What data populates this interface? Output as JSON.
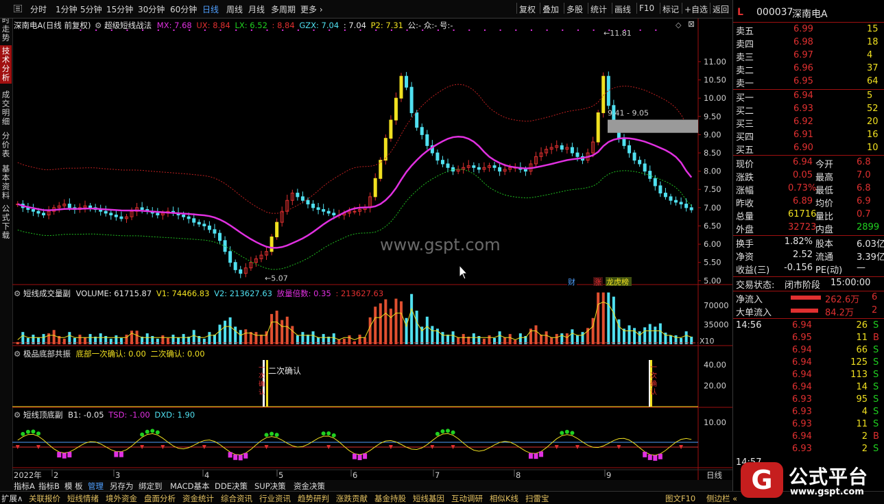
{
  "toolbar": {
    "periods": [
      "分时",
      "1分钟",
      "5分钟",
      "15分钟",
      "30分钟",
      "60分钟",
      "日线",
      "周线",
      "月线",
      "多周期",
      "更多"
    ],
    "active_period": "日线",
    "right_buttons": [
      "复权",
      "叠加",
      "多股",
      "统计",
      "画线",
      "F10",
      "标记",
      "+自选",
      "返回"
    ]
  },
  "left_tabs": [
    {
      "label": "分时走势",
      "active": false
    },
    {
      "label": "技术分析",
      "active": true
    },
    {
      "label": "成交明细",
      "active": false
    },
    {
      "label": "分价表",
      "active": false
    },
    {
      "label": "基本资料",
      "active": false
    },
    {
      "label": "公式下载",
      "active": false
    }
  ],
  "main_info": {
    "title": "深南电A(日线 前复权)",
    "indicator": "超级短线战法",
    "mx_label": "MX: 7.68",
    "ux_label": "UX: 8.84",
    "lx_label": "LX: 6.52",
    "v4_label": ": 8.84",
    "gzx_label": "GZX: 7.04",
    "v6_label": ": 7.04",
    "p2_label": "P2: 7.31",
    "tail_label": "公:- 众:- 号:-"
  },
  "annotations": {
    "high": "11.81",
    "low": "5.07",
    "zone": "9.41 - 9.05",
    "watermark": "www.gspt.com",
    "tags": [
      "财",
      "涨",
      "龙虎榜"
    ],
    "confirm1": "二次确认",
    "confirm2": "一次确认",
    "confirm_left": "一次确认"
  },
  "vol_info": {
    "title": "短线成交量副",
    "volume": "VOLUME: 61715.87",
    "v1": "V1: 74466.83",
    "v2": "V2: 213627.63",
    "ratio": "放量倍数: 0.35",
    "ratio2": ": 213627.63",
    "x10": "X10"
  },
  "res_info": {
    "title": "极品底部共振",
    "first": "底部一次确认: 0.00",
    "second": "二次确认: 0.00"
  },
  "td_info": {
    "title": "短线顶底副",
    "b1": "B1: -0.05",
    "tsd": "TSD: -1.00",
    "dxd": "DXD: 1.90"
  },
  "price_axis": [
    "11.00",
    "10.50",
    "10.00",
    "9.50",
    "9.00",
    "8.50",
    "8.00",
    "7.50",
    "7.00",
    "6.50",
    "6.00",
    "5.50",
    "5.00"
  ],
  "vol_axis": [
    "70000",
    "35000"
  ],
  "res_axis": [
    "40.00",
    "20.00"
  ],
  "td_axis": [
    "10.00"
  ],
  "date_axis": {
    "year": "2022年",
    "months": [
      "2",
      "3",
      "4",
      "5",
      "6",
      "7",
      "8",
      "9"
    ],
    "period": "日线"
  },
  "bottom_tabs": [
    "指标A",
    "指标B",
    "模 板",
    "管理",
    "另存为",
    "绑定到",
    "MACD基本",
    "DDE决策",
    "SUP决策",
    "资金决策"
  ],
  "footer_tabs": [
    "扩展∧",
    "关联报价",
    "短线情绪",
    "境外资金",
    "盘面分析",
    "资金统计",
    "综合资讯",
    "行业资讯",
    "趋势研判",
    "涨跌贡献",
    "基金持股",
    "短线基因",
    "互动调研",
    "相似K线",
    "扫雷宝",
    "图文F10",
    "侧边栏 «"
  ],
  "quote": {
    "flag": "L",
    "code": "000037",
    "name": "深南电A",
    "asks": [
      {
        "label": "卖五",
        "price": "6.99",
        "vol": "15"
      },
      {
        "label": "卖四",
        "price": "6.98",
        "vol": "18"
      },
      {
        "label": "卖三",
        "price": "6.97",
        "vol": "4"
      },
      {
        "label": "卖二",
        "price": "6.96",
        "vol": "37"
      },
      {
        "label": "卖一",
        "price": "6.95",
        "vol": "64"
      }
    ],
    "bids": [
      {
        "label": "买一",
        "price": "6.94",
        "vol": "5"
      },
      {
        "label": "买二",
        "price": "6.93",
        "vol": "52"
      },
      {
        "label": "买三",
        "price": "6.92",
        "vol": "20"
      },
      {
        "label": "买四",
        "price": "6.91",
        "vol": "16"
      },
      {
        "label": "买五",
        "price": "6.90",
        "vol": "10"
      }
    ],
    "stats": [
      {
        "l1": "现价",
        "v1": "6.94",
        "l2": "今开",
        "v2": "6.8"
      },
      {
        "l1": "涨跌",
        "v1": "0.05",
        "l2": "最高",
        "v2": "7.0"
      },
      {
        "l1": "涨幅",
        "v1": "0.73%",
        "l2": "最低",
        "v2": "6.8"
      },
      {
        "l1": "昨收",
        "v1": "6.89",
        "l2": "均价",
        "v2": "6.9"
      },
      {
        "l1": "总量",
        "v1": "61716",
        "l2": "量比",
        "v2": "0.7"
      },
      {
        "l1": "外盘",
        "v1": "32723",
        "l2": "内盘",
        "v2": "2899"
      }
    ],
    "stats2": [
      {
        "l1": "换手",
        "v1": "1.82%",
        "l2": "股本",
        "v2": "6.03亿"
      },
      {
        "l1": "净资",
        "v1": "2.52",
        "l2": "流通",
        "v2": "3.39亿"
      },
      {
        "l1": "收益(三)",
        "v1": "-0.156",
        "l2": "PE(动)",
        "v2": "—"
      }
    ],
    "status_label": "交易状态:",
    "status_value": "闭市阶段",
    "status_time": "15:00:00",
    "flow": [
      {
        "label": "净流入",
        "value": "262.6万",
        "tail": "6"
      },
      {
        "label": "大单流入",
        "value": "84.2万",
        "tail": "2"
      }
    ],
    "ticks_time": "14:56",
    "ticks": [
      {
        "price": "6.94",
        "vol": "26",
        "side": "S"
      },
      {
        "price": "6.95",
        "vol": "11",
        "side": "B"
      },
      {
        "price": "6.94",
        "vol": "66",
        "side": "S"
      },
      {
        "price": "6.94",
        "vol": "125",
        "side": "S"
      },
      {
        "price": "6.94",
        "vol": "113",
        "side": "S"
      },
      {
        "price": "6.94",
        "vol": "14",
        "side": "S"
      },
      {
        "price": "6.93",
        "vol": "95",
        "side": "S"
      },
      {
        "price": "6.93",
        "vol": "4",
        "side": "S"
      },
      {
        "price": "6.93",
        "vol": "11",
        "side": "S"
      },
      {
        "price": "6.94",
        "vol": "2",
        "side": "B"
      },
      {
        "price": "6.93",
        "vol": "2",
        "side": "S"
      }
    ],
    "last_time": "14:57"
  },
  "logo": {
    "glyph": "G",
    "text": "公式平台",
    "url": "www.gspt.com"
  },
  "colors": {
    "up": "#e03030",
    "down": "#50e0f0",
    "ma": "#e030e0",
    "band_up": "#c02020",
    "band_dn": "#20c020",
    "yellow": "#f0e020",
    "accent": "#a01010"
  },
  "chart_data": {
    "type": "candlestick",
    "price_range": [
      4.95,
      11.9
    ],
    "high_label": 11.81,
    "low_label": 5.07,
    "zone": [
      9.05,
      9.41
    ],
    "closes": [
      7.1,
      7.0,
      6.95,
      6.9,
      6.85,
      6.8,
      6.9,
      7.0,
      7.05,
      7.1,
      7.0,
      6.95,
      7.0,
      7.05,
      7.0,
      6.95,
      6.9,
      6.85,
      6.8,
      6.75,
      6.7,
      6.75,
      6.9,
      7.0,
      6.95,
      6.9,
      6.85,
      6.8,
      6.85,
      6.9,
      6.85,
      6.8,
      6.75,
      6.7,
      6.6,
      6.55,
      6.5,
      6.4,
      6.3,
      6.1,
      5.8,
      5.5,
      5.3,
      5.2,
      5.35,
      5.5,
      5.6,
      5.7,
      5.8,
      6.2,
      6.6,
      6.9,
      7.2,
      7.4,
      7.3,
      7.2,
      7.1,
      7.0,
      6.95,
      6.9,
      6.85,
      6.8,
      6.8,
      6.85,
      6.9,
      6.9,
      6.95,
      7.0,
      7.3,
      7.8,
      8.3,
      8.9,
      9.4,
      10.0,
      10.6,
      10.3,
      9.6,
      9.2,
      9.0,
      8.7,
      8.5,
      8.3,
      8.2,
      8.1,
      8.0,
      8.05,
      8.1,
      8.15,
      8.1,
      8.05,
      8.1,
      8.15,
      8.1,
      8.0,
      8.05,
      8.1,
      8.1,
      8.05,
      8.0,
      8.2,
      8.4,
      8.5,
      8.6,
      8.65,
      8.7,
      8.6,
      8.65,
      8.5,
      8.4,
      8.3,
      8.5,
      8.8,
      9.6,
      10.6,
      9.8,
      9.2,
      8.9,
      8.7,
      8.5,
      8.3,
      8.2,
      8.0,
      7.8,
      7.6,
      7.4,
      7.3,
      7.2,
      7.15,
      7.1,
      7.0,
      6.94
    ],
    "volume_range": [
      0,
      95000
    ],
    "volume_last": 61715.87,
    "resonance_marks": [
      {
        "x": "5",
        "value": 50
      },
      {
        "x": "9",
        "value": 50
      }
    ]
  }
}
